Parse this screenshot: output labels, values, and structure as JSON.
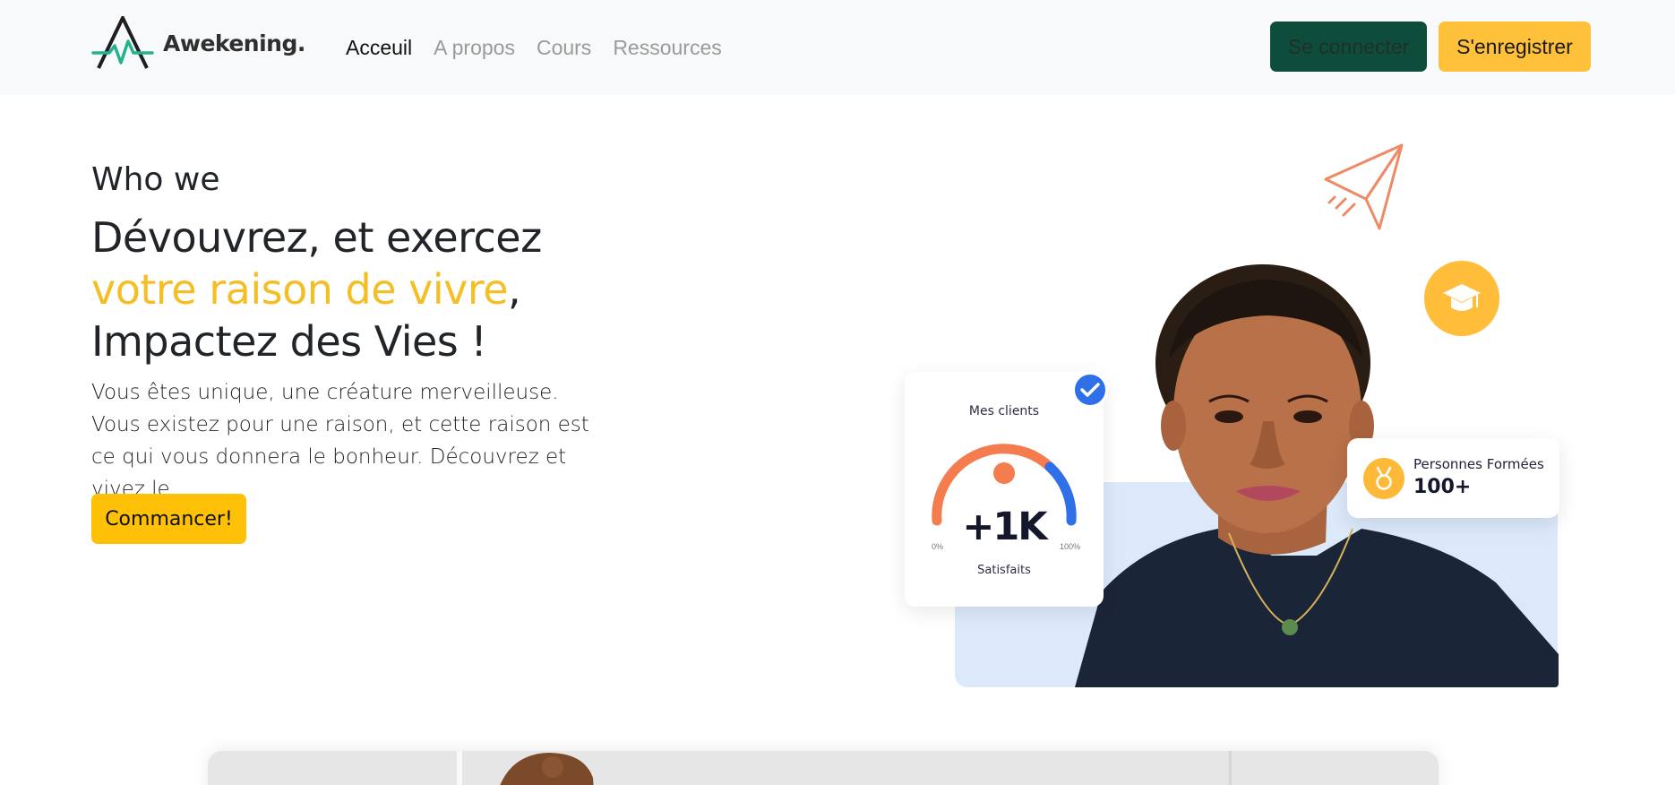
{
  "brand": {
    "name": "Awekening.",
    "logo_icon": "mountain-pulse-logo"
  },
  "nav": {
    "links": [
      {
        "label": "Acceuil",
        "active": true
      },
      {
        "label": "A propos",
        "active": false
      },
      {
        "label": "Cours",
        "active": false
      },
      {
        "label": "Ressources",
        "active": false
      }
    ],
    "login_label": "Se connecter",
    "register_label": "S'enregistrer"
  },
  "hero": {
    "eyebrow": "Who we",
    "headline_line1": "Dévouvrez, et exercez",
    "headline_accent": "votre raison de vivre",
    "headline_comma": ",",
    "headline_line3": "Impactez des Vies !",
    "lead": "Vous êtes unique, une créature merveilleuse. Vous existez pour une raison, et cette raison est ce qui vous donnera le bonheur. Découvrez et vivez le.",
    "cta_label": "Commancer!"
  },
  "stats_card": {
    "title": "Mes clients",
    "value": "+1K",
    "subtitle": "Satisfaits",
    "min_label": "0%",
    "max_label": "100%"
  },
  "trained_card": {
    "label": "Personnes Formées",
    "value": "100+"
  },
  "colors": {
    "accent_yellow": "#ffc107",
    "login_green": "#0e4d3c",
    "register_yellow": "#ffc03a",
    "gauge_orange": "#f47c4e",
    "gauge_blue": "#2f6fe8",
    "panel_blue": "#dbe9fb"
  }
}
